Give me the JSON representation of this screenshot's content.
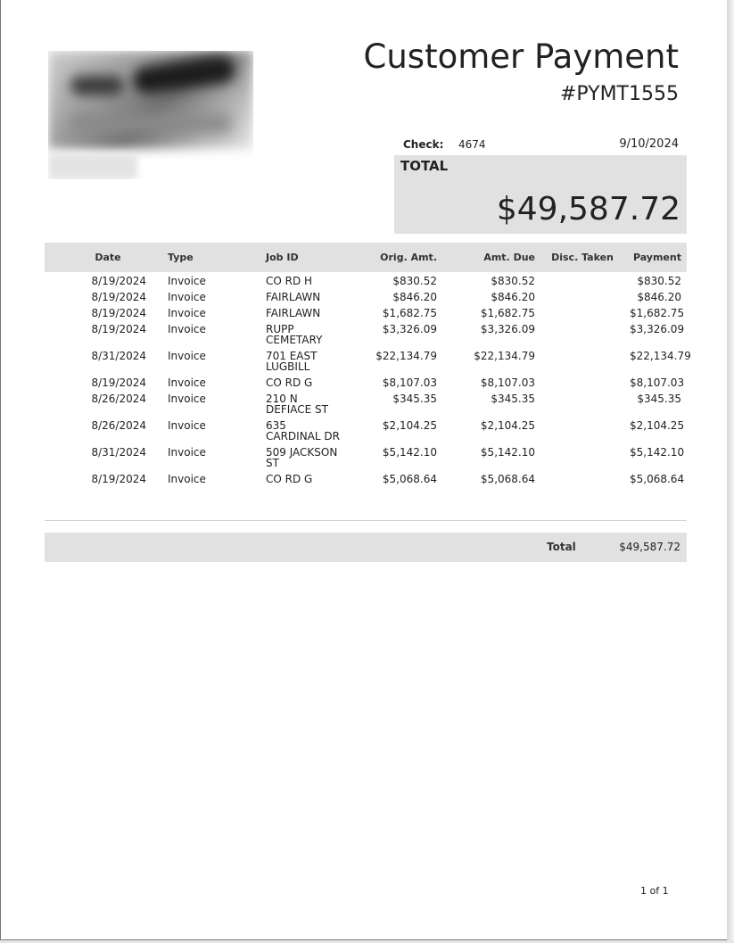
{
  "header": {
    "title": "Customer Payment",
    "number": "#PYMT1555"
  },
  "payment": {
    "check_label": "Check:",
    "check_number": "4674",
    "date": "9/10/2024",
    "total_label": "TOTAL",
    "total_amount": "$49,587.72"
  },
  "table": {
    "columns": [
      "Date",
      "Type",
      "Job ID",
      "Orig. Amt.",
      "Amt. Due",
      "Disc. Taken",
      "Payment"
    ],
    "rows": [
      [
        "8/19/2024",
        "Invoice",
        "CO RD H",
        "$830.52",
        "$830.52",
        "",
        "$830.52"
      ],
      [
        "8/19/2024",
        "Invoice",
        "FAIRLAWN",
        "$846.20",
        "$846.20",
        "",
        "$846.20"
      ],
      [
        "8/19/2024",
        "Invoice",
        "FAIRLAWN",
        "$1,682.75",
        "$1,682.75",
        "",
        "$1,682.75"
      ],
      [
        "8/19/2024",
        "Invoice",
        "RUPP CEMETARY",
        "$3,326.09",
        "$3,326.09",
        "",
        "$3,326.09"
      ],
      [
        "8/31/2024",
        "Invoice",
        "701 EAST LUGBILL",
        "$22,134.79",
        "$22,134.79",
        "",
        "$22,134.79"
      ],
      [
        "8/19/2024",
        "Invoice",
        "CO RD G",
        "$8,107.03",
        "$8,107.03",
        "",
        "$8,107.03"
      ],
      [
        "8/26/2024",
        "Invoice",
        "210 N DEFIACE ST",
        "$345.35",
        "$345.35",
        "",
        "$345.35"
      ],
      [
        "8/26/2024",
        "Invoice",
        "635 CARDINAL DR",
        "$2,104.25",
        "$2,104.25",
        "",
        "$2,104.25"
      ],
      [
        "8/31/2024",
        "Invoice",
        "509 JACKSON ST",
        "$5,142.10",
        "$5,142.10",
        "",
        "$5,142.10"
      ],
      [
        "8/19/2024",
        "Invoice",
        "CO RD G",
        "$5,068.64",
        "$5,068.64",
        "",
        "$5,068.64"
      ]
    ]
  },
  "summary": {
    "total_label": "Total",
    "total_value": "$49,587.72"
  },
  "footer": {
    "page": "1 of 1"
  }
}
